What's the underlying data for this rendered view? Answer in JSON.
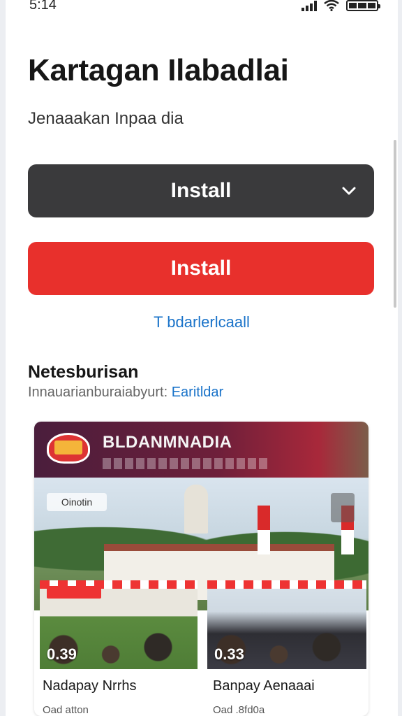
{
  "status_bar": {
    "time": "5:14"
  },
  "header": {
    "title": "Kartagan Ilabadlai",
    "subtitle": "Jenaaakan Inpaa dia"
  },
  "actions": {
    "primary_dropdown_label": "Install",
    "install_label": "Install",
    "secondary_link": "T bdarlerlcaall"
  },
  "section": {
    "title": "Netesburisan",
    "subtitle": "Innauarianburaiabyurt:",
    "subtitle_link": "Earitldar"
  },
  "card": {
    "banner_title": "BLDANMNADIA",
    "overlay_badge": "Oinotin",
    "videos": [
      {
        "duration": "0.39",
        "title": "Nadapay Nrrhs",
        "meta": "Oad atton"
      },
      {
        "duration": "0.33",
        "title": "Banpay Aenaaai",
        "meta": "Oad .8fd0a"
      }
    ]
  },
  "colors": {
    "primary_dark": "#3a3a3c",
    "accent_red": "#e8302c",
    "link_blue": "#1a73c9"
  },
  "icons": [
    "signal-icon",
    "wifi-icon",
    "battery-icon",
    "chevron-down-icon",
    "bookmark-icon"
  ]
}
